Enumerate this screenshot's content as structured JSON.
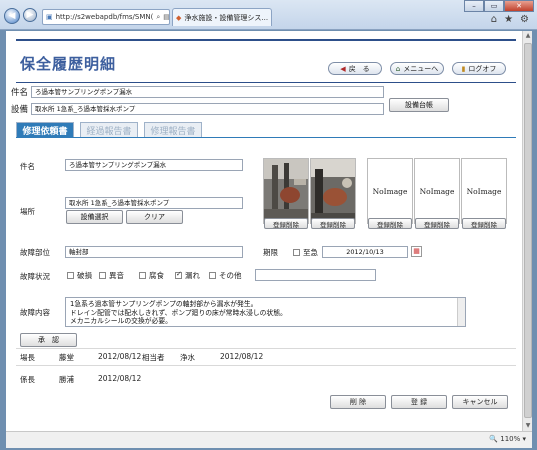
{
  "browser": {
    "url": "http://s2webapdb/fms/SMN(",
    "tab_title": "浄水施設・設備管理シス...",
    "zoom": "110%"
  },
  "page": {
    "title": "保全履歴明細",
    "buttons": {
      "back": "戻　る",
      "menu": "メニューへ",
      "logoff": "ログオフ"
    }
  },
  "header": {
    "name_label": "件名",
    "name_value": "ろ過本管サンプリングポンプ漏水",
    "equipment_label": "設備",
    "equipment_value": "取水所 1急系_ろ過本管採水ポンプ",
    "ledger_button": "設備台帳"
  },
  "tabs": [
    {
      "label": "修理依頼書",
      "active": true
    },
    {
      "label": "経過報告書",
      "active": false
    },
    {
      "label": "修理報告書",
      "active": false
    }
  ],
  "form": {
    "subject_label": "件名",
    "subject_value": "ろ過本管サンプリングポンプ漏水",
    "location_label": "場所",
    "location_value": "取水所 1急系_ろ過本管採水ポンプ",
    "select_equipment_button": "設備選択",
    "clear_button": "クリア",
    "part_label": "故障部位",
    "part_value": "軸封部",
    "deadline_label": "期限",
    "urgent_label": "至急",
    "urgent_checked": false,
    "deadline_value": "2012/10/13",
    "status_label": "故障状況",
    "status_options": [
      {
        "label": "破損",
        "checked": false
      },
      {
        "label": "異音",
        "checked": false
      },
      {
        "label": "腐食",
        "checked": false
      },
      {
        "label": "漏れ",
        "checked": true
      },
      {
        "label": "その他",
        "checked": false
      }
    ],
    "content_label": "故障内容",
    "content_lines": [
      "1急系ろ過本管サンプリングポンプの軸封部から漏水が発生。",
      "ドレイン配管では配水しきれず、ポンプ廻りの床が常時水浸しの状態。",
      "メカニカルシールの交換が必要。"
    ],
    "approve_button": "承　認"
  },
  "photos": [
    {
      "type": "image"
    },
    {
      "type": "image"
    },
    {
      "type": "noimage",
      "text": "NoImage"
    },
    {
      "type": "noimage",
      "text": "NoImage"
    },
    {
      "type": "noimage",
      "text": "NoImage"
    }
  ],
  "photo_button": "登録削除",
  "approvals": {
    "row1": {
      "role": "場長",
      "name": "藤堂",
      "date": "2012/08/12",
      "role2": "相当者",
      "name2": "浄水",
      "date2": "2012/08/12"
    },
    "row2": {
      "role": "係長",
      "name": "勝浦",
      "date": "2012/08/12"
    }
  },
  "footer": {
    "delete": "削 除",
    "register": "登 録",
    "cancel": "キャンセル"
  }
}
